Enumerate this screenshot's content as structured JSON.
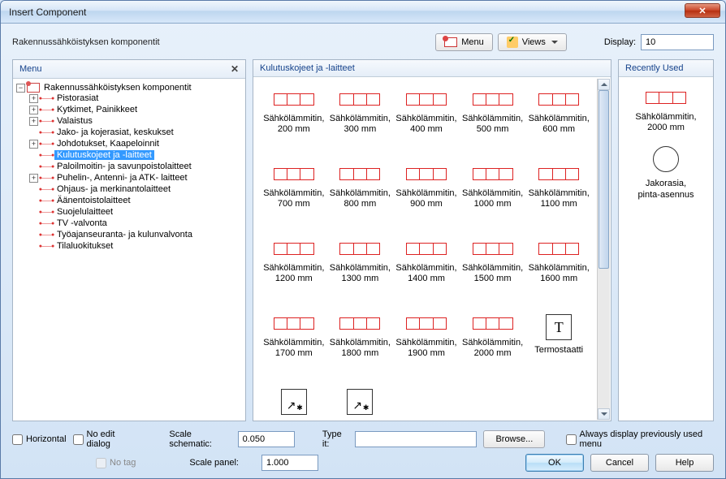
{
  "window": {
    "title": "Insert Component"
  },
  "toprow": {
    "subtitle": "Rakennussähköistyksen komponentit",
    "menu_btn": "Menu",
    "views_btn": "Views",
    "display_label": "Display:",
    "display_value": "10"
  },
  "menu_panel": {
    "title": "Menu",
    "root": "Rakennussähköistyksen komponentit",
    "items": [
      {
        "label": "Pistorasiat",
        "expandable": true
      },
      {
        "label": "Kytkimet, Painikkeet",
        "expandable": true
      },
      {
        "label": "Valaistus",
        "expandable": true
      },
      {
        "label": "Jako- ja kojerasiat, keskukset",
        "expandable": false
      },
      {
        "label": "Johdotukset, Kaapeloinnit",
        "expandable": true
      },
      {
        "label": "Kulutuskojeet ja -laitteet",
        "expandable": false,
        "selected": true
      },
      {
        "label": "Paloilmoitin- ja savunpoistolaitteet",
        "expandable": false
      },
      {
        "label": "Puhelin-, Antenni- ja ATK- laitteet",
        "expandable": true
      },
      {
        "label": "Ohjaus- ja merkinantolaitteet",
        "expandable": false
      },
      {
        "label": "Äänentoistolaitteet",
        "expandable": false
      },
      {
        "label": "Suojelulaitteet",
        "expandable": false
      },
      {
        "label": "TV -valvonta",
        "expandable": false
      },
      {
        "label": "Työajanseuranta- ja kulunvalvonta",
        "expandable": false
      },
      {
        "label": "Tilaluokitukset",
        "expandable": false
      }
    ]
  },
  "gallery": {
    "title": "Kulutuskojeet ja -laitteet",
    "items": [
      {
        "name": "Sähkölämmitin,",
        "sub": "200 mm",
        "type": "heater"
      },
      {
        "name": "Sähkölämmitin,",
        "sub": "300 mm",
        "type": "heater"
      },
      {
        "name": "Sähkölämmitin,",
        "sub": "400 mm",
        "type": "heater"
      },
      {
        "name": "Sähkölämmitin,",
        "sub": "500 mm",
        "type": "heater"
      },
      {
        "name": "Sähkölämmitin,",
        "sub": "600 mm",
        "type": "heater"
      },
      {
        "name": "Sähkölämmitin,",
        "sub": "700 mm",
        "type": "heater"
      },
      {
        "name": "Sähkölämmitin,",
        "sub": "800 mm",
        "type": "heater"
      },
      {
        "name": "Sähkölämmitin,",
        "sub": "900 mm",
        "type": "heater"
      },
      {
        "name": "Sähkölämmitin,",
        "sub": "1000 mm",
        "type": "heater"
      },
      {
        "name": "Sähkölämmitin,",
        "sub": "1100 mm",
        "type": "heater"
      },
      {
        "name": "Sähkölämmitin,",
        "sub": "1200 mm",
        "type": "heater"
      },
      {
        "name": "Sähkölämmitin,",
        "sub": "1300 mm",
        "type": "heater"
      },
      {
        "name": "Sähkölämmitin,",
        "sub": "1400 mm",
        "type": "heater"
      },
      {
        "name": "Sähkölämmitin,",
        "sub": "1500 mm",
        "type": "heater"
      },
      {
        "name": "Sähkölämmitin,",
        "sub": "1600 mm",
        "type": "heater"
      },
      {
        "name": "Sähkölämmitin,",
        "sub": "1700 mm",
        "type": "heater"
      },
      {
        "name": "Sähkölämmitin,",
        "sub": "1800 mm",
        "type": "heater"
      },
      {
        "name": "Sähkölämmitin,",
        "sub": "1900 mm",
        "type": "heater"
      },
      {
        "name": "Sähkölämmitin,",
        "sub": "2000 mm",
        "type": "heater"
      },
      {
        "name": "Termostaatti",
        "sub": "",
        "type": "thermo"
      },
      {
        "name": "",
        "sub": "",
        "type": "misc"
      },
      {
        "name": "",
        "sub": "",
        "type": "misc"
      }
    ]
  },
  "recent": {
    "title": "Recently Used",
    "items": [
      {
        "name": "Sähkölämmitin,",
        "sub": "2000 mm",
        "type": "heater"
      },
      {
        "name": "Jakorasia,",
        "sub": "pinta-asennus",
        "type": "circle"
      }
    ]
  },
  "bottom": {
    "horizontal": "Horizontal",
    "no_edit": "No edit dialog",
    "no_tag": "No tag",
    "scale_schematic_label": "Scale schematic:",
    "scale_schematic_value": "0.050",
    "scale_panel_label": "Scale panel:",
    "scale_panel_value": "1.000",
    "type_it_label": "Type it:",
    "type_it_value": "",
    "browse": "Browse...",
    "always_display": "Always display previously used menu",
    "ok": "OK",
    "cancel": "Cancel",
    "help": "Help"
  }
}
